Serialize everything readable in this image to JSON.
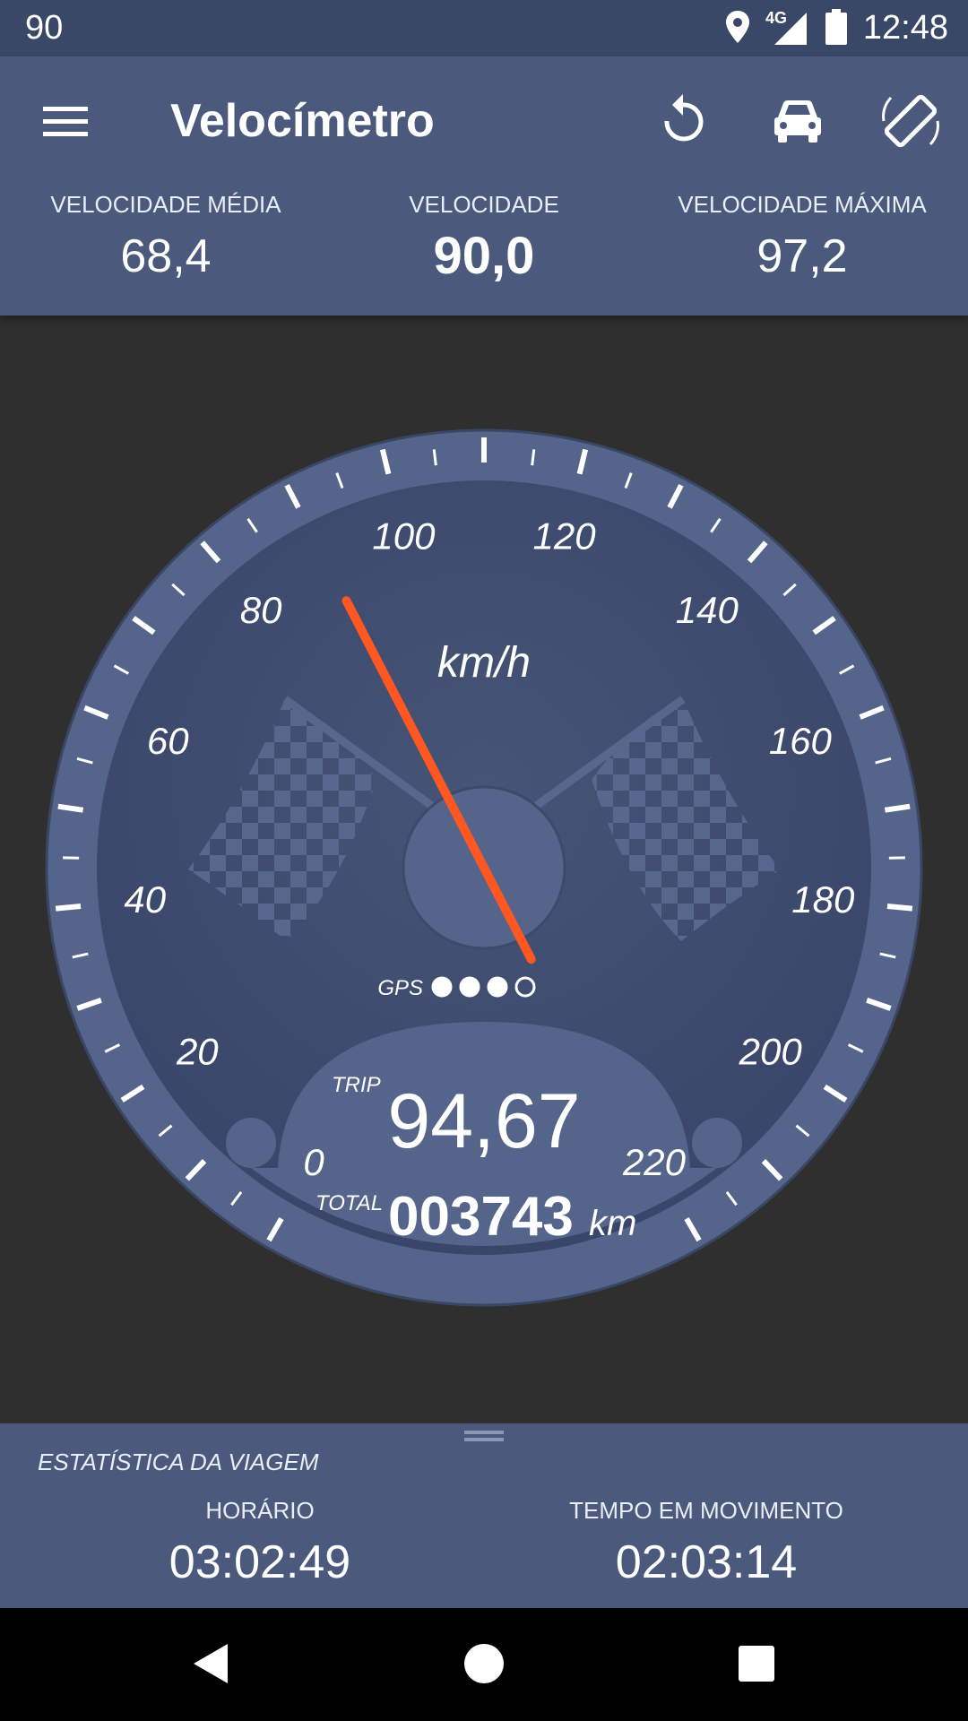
{
  "status_bar": {
    "left_text": "90",
    "network": "4G",
    "time": "12:48",
    "icons": [
      "location-icon",
      "signal-icon",
      "battery-icon"
    ]
  },
  "app_bar": {
    "title": "Velocímetro",
    "icons": [
      "menu-icon",
      "reset-icon",
      "car-icon",
      "screen-rotation-icon"
    ]
  },
  "speed_stats": {
    "average": {
      "label": "VELOCIDADE MÉDIA",
      "value": "68,4"
    },
    "current": {
      "label": "VELOCIDADE",
      "value": "90,0"
    },
    "maximum": {
      "label": "VELOCIDADE MÁXIMA",
      "value": "97,2"
    }
  },
  "gauge": {
    "unit": "km/h",
    "current_speed": 90,
    "scale_min": 0,
    "scale_max": 220,
    "scale_labels": [
      "0",
      "20",
      "40",
      "60",
      "80",
      "100",
      "120",
      "140",
      "160",
      "180",
      "200",
      "220"
    ],
    "gps_label": "GPS",
    "gps_signal": {
      "filled": 3,
      "total": 4
    },
    "trip_label": "TRIP",
    "trip_value": "94,67",
    "total_label": "TOTAL",
    "total_value": "003743",
    "distance_unit": "km"
  },
  "trip_stats": {
    "title": "ESTATÍSTICA DA VIAGEM",
    "clock": {
      "label": "HORÁRIO",
      "value": "03:02:49"
    },
    "moving_time": {
      "label": "TEMPO EM MOVIMENTO",
      "value": "02:03:14"
    }
  },
  "colors": {
    "status_bar": "#3a4868",
    "app_bar": "#4b5a7c",
    "background": "#2f2f2f",
    "dial_face": "#3f4c6c",
    "bezel": "#55648a",
    "needle": "#ff5722"
  },
  "nav_bar": {
    "icons": [
      "back-icon",
      "home-icon",
      "recents-icon"
    ]
  }
}
